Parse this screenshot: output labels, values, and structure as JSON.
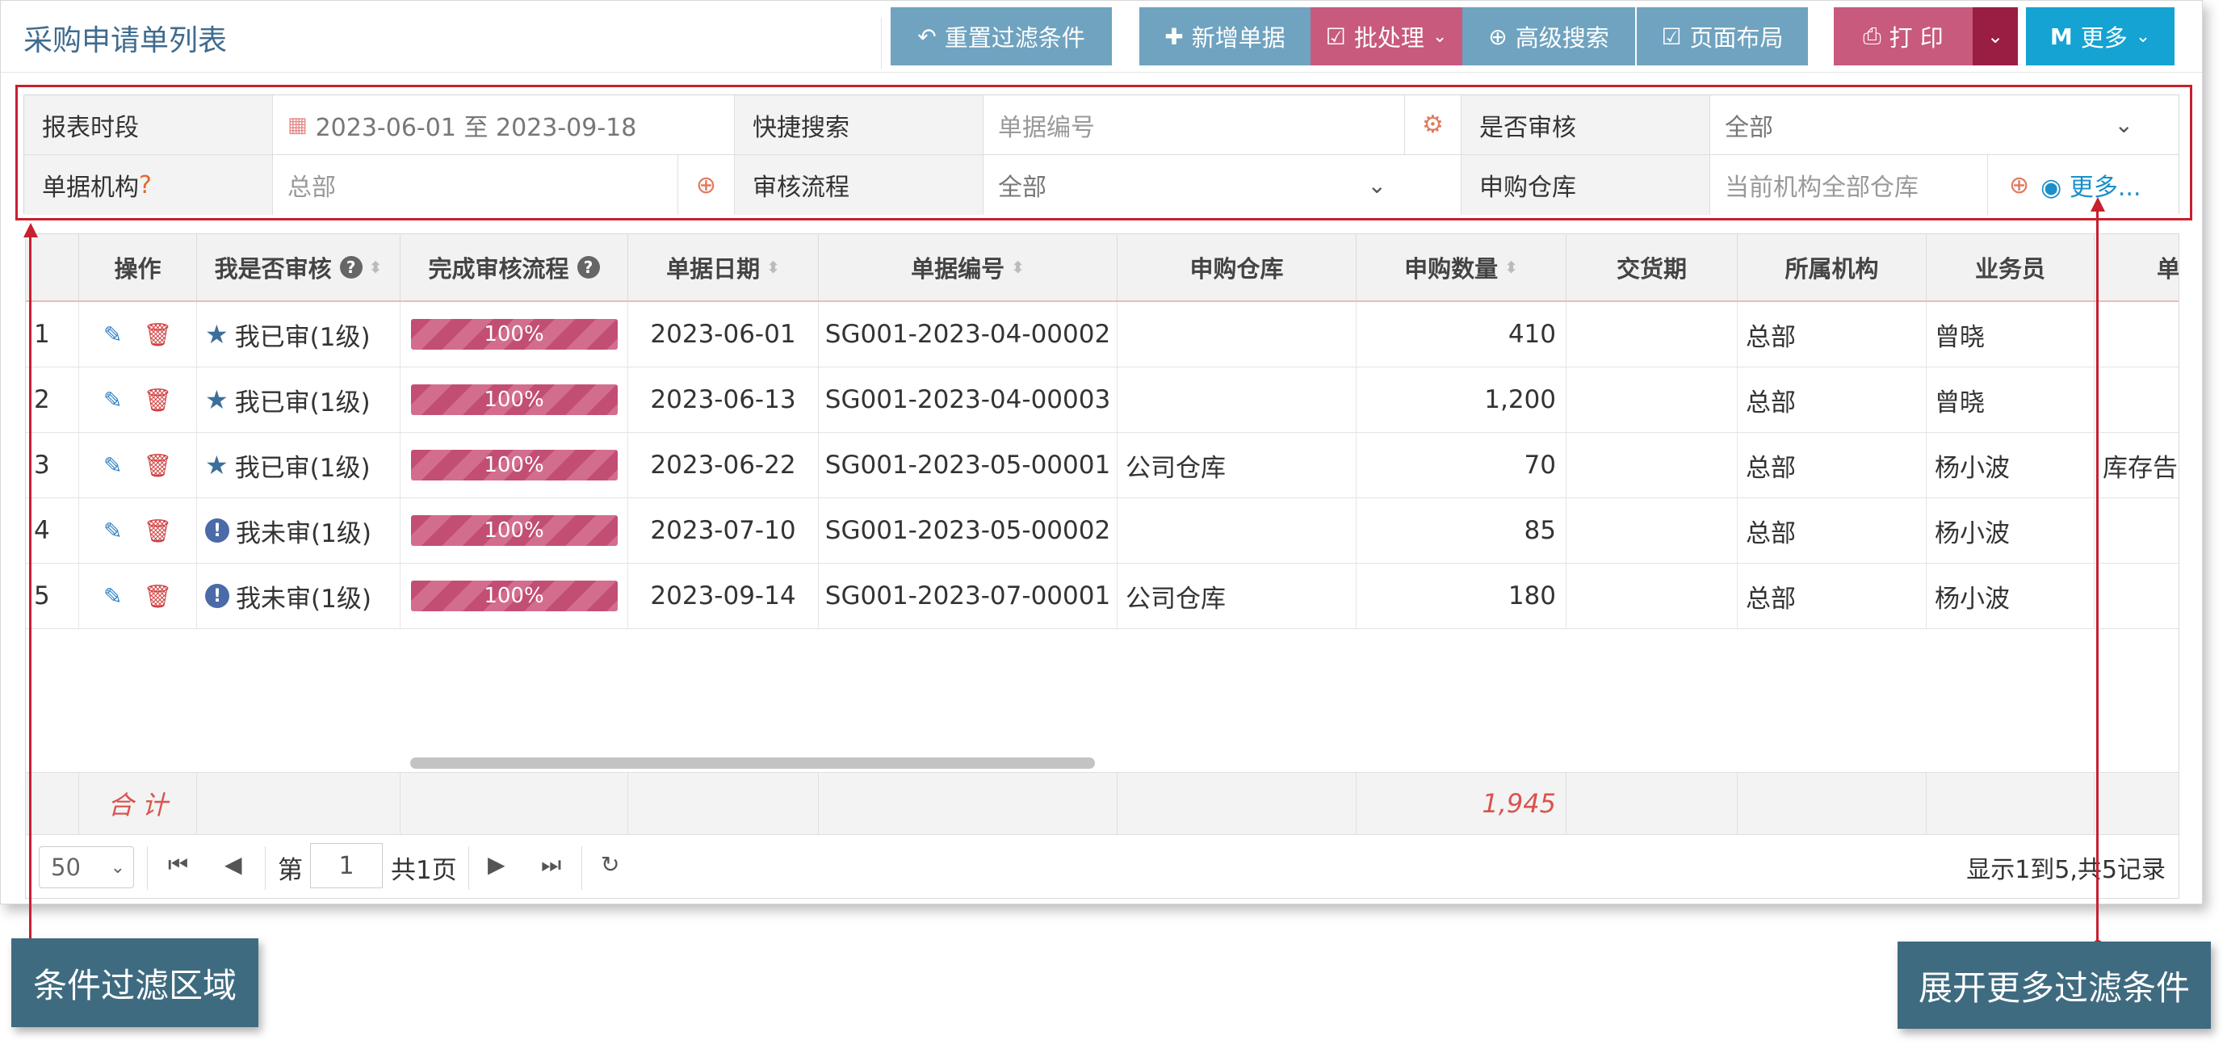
{
  "page": {
    "title": "采购申请单列表"
  },
  "toolbar": {
    "reset": "重置过滤条件",
    "add": "新增单据",
    "batch": "批处理",
    "advanced": "高级搜索",
    "layout": "页面布局",
    "print": "打 印",
    "more": "更多"
  },
  "filters": {
    "period_label": "报表时段",
    "period_value": "2023-06-01 至 2023-09-18",
    "quick_label": "快捷搜索",
    "quick_placeholder": "单据编号",
    "audit_label": "是否审核",
    "audit_value": "全部",
    "org_label": "单据机构",
    "org_help": "?",
    "org_value": "总部",
    "flow_label": "审核流程",
    "flow_value": "全部",
    "warehouse_label": "申购仓库",
    "warehouse_placeholder": "当前机构全部仓库",
    "more_link": "更多..."
  },
  "table": {
    "columns": [
      "操作",
      "我是否审核",
      "完成审核流程",
      "单据日期",
      "单据编号",
      "申购仓库",
      "申购数量",
      "交货期",
      "所属机构",
      "业务员",
      "单"
    ],
    "rows": [
      {
        "no": "1",
        "audit": "我已审(1级)",
        "audited": true,
        "progress": "100%",
        "date": "2023-06-01",
        "code": "SG001-2023-04-00002",
        "warehouse": "",
        "qty": "410",
        "delivery": "",
        "org": "总部",
        "staff": "曾晓",
        "extra": ""
      },
      {
        "no": "2",
        "audit": "我已审(1级)",
        "audited": true,
        "progress": "100%",
        "date": "2023-06-13",
        "code": "SG001-2023-04-00003",
        "warehouse": "",
        "qty": "1,200",
        "delivery": "",
        "org": "总部",
        "staff": "曾晓",
        "extra": ""
      },
      {
        "no": "3",
        "audit": "我已审(1级)",
        "audited": true,
        "progress": "100%",
        "date": "2023-06-22",
        "code": "SG001-2023-05-00001",
        "warehouse": "公司仓库",
        "qty": "70",
        "delivery": "",
        "org": "总部",
        "staff": "杨小波",
        "extra": "库存告"
      },
      {
        "no": "4",
        "audit": "我未审(1级)",
        "audited": false,
        "progress": "100%",
        "date": "2023-07-10",
        "code": "SG001-2023-05-00002",
        "warehouse": "",
        "qty": "85",
        "delivery": "",
        "org": "总部",
        "staff": "杨小波",
        "extra": ""
      },
      {
        "no": "5",
        "audit": "我未审(1级)",
        "audited": false,
        "progress": "100%",
        "date": "2023-09-14",
        "code": "SG001-2023-07-00001",
        "warehouse": "公司仓库",
        "qty": "180",
        "delivery": "",
        "org": "总部",
        "staff": "杨小波",
        "extra": ""
      }
    ],
    "summary_label": "合 计",
    "summary_qty": "1,945"
  },
  "pager": {
    "page_size": "50",
    "page_prefix": "第",
    "page_value": "1",
    "page_suffix": "共1页",
    "info": "显示1到5,共5记录"
  },
  "annotations": {
    "left": "条件过滤区域",
    "right": "展开更多过滤条件"
  },
  "icons": {
    "reset": "undo-icon",
    "add": "plus-icon",
    "batch": "check-square-icon",
    "advanced": "zoom-icon",
    "layout": "check-square-icon",
    "print": "printer-icon",
    "more": "m-icon",
    "edit": "edit-icon",
    "delete": "trash-icon",
    "star": "star-icon",
    "alert": "exclamation-circle-icon",
    "refresh": "refresh-icon",
    "calendar": "calendar-icon",
    "gears": "gears-icon",
    "search": "search-plus-icon",
    "eye": "eye-icon"
  },
  "colors": {
    "accent_red": "#c8202f",
    "button_blue": "#6fa3c0",
    "button_pink": "#c85a7d",
    "button_cyan": "#14a3d2",
    "title": "#3f6b8f"
  }
}
